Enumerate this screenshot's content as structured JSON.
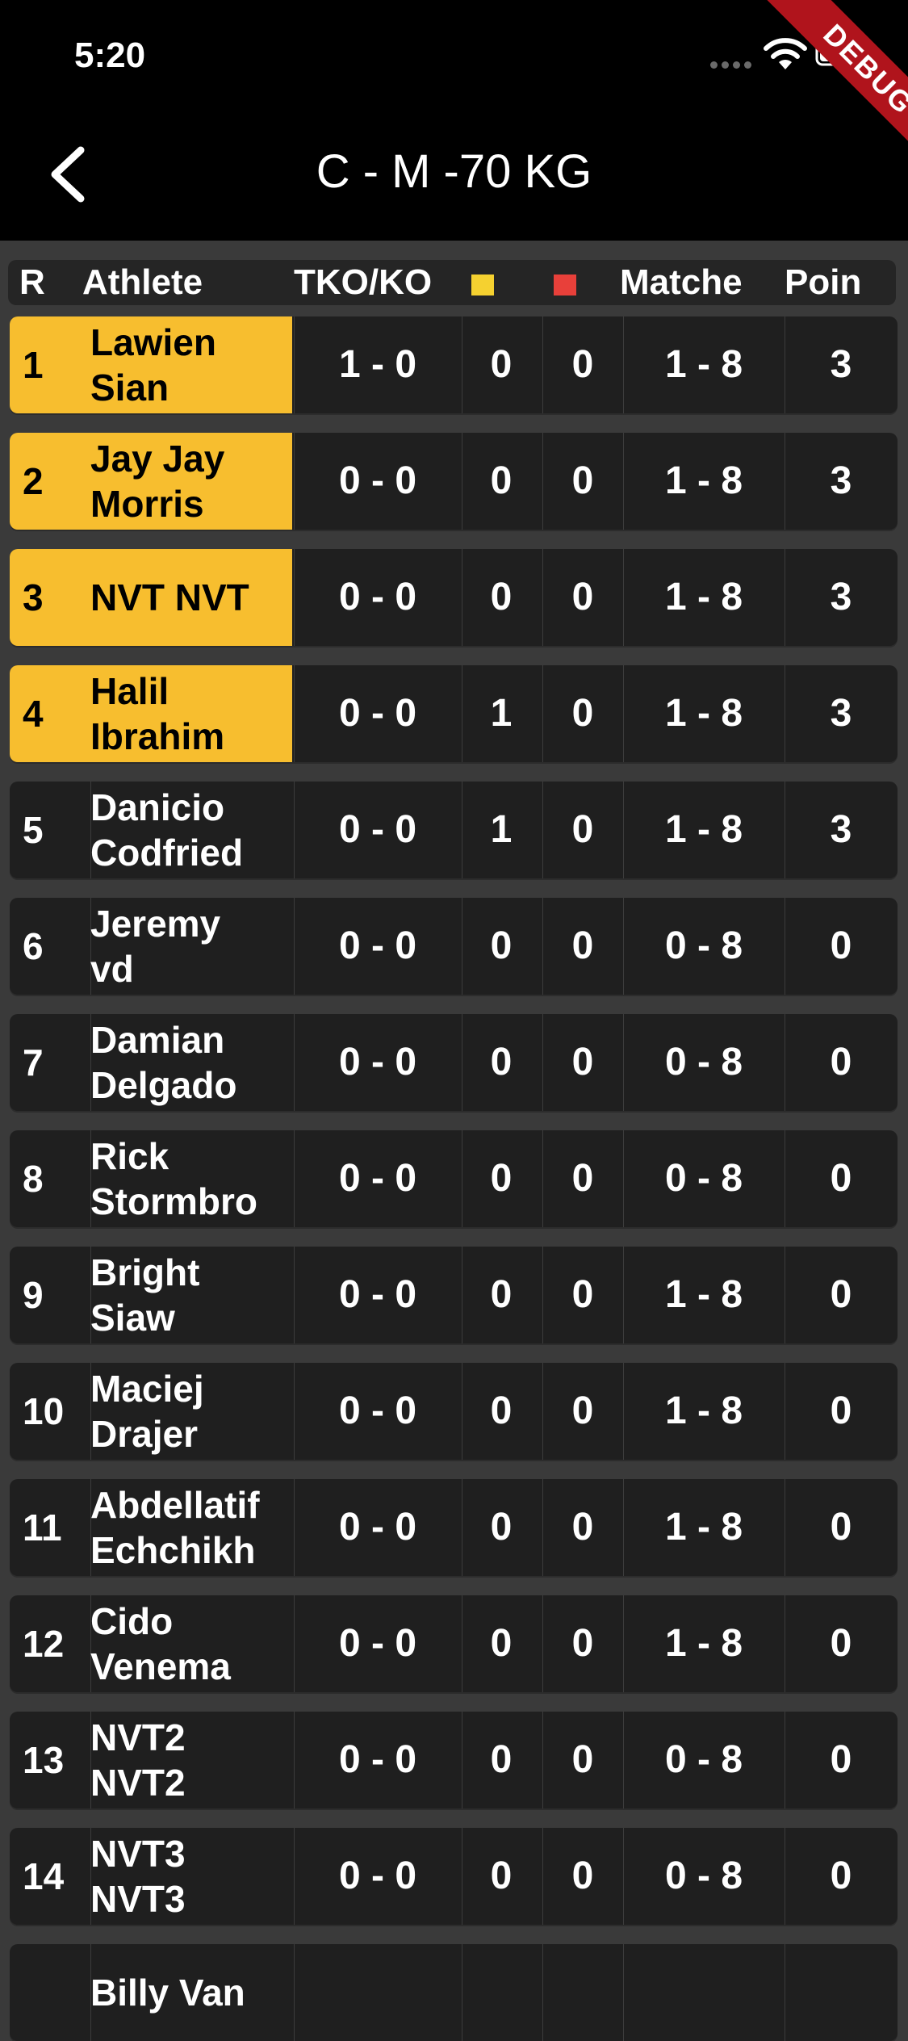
{
  "status_bar": {
    "time": "5:20",
    "debug_label": "DEBUG"
  },
  "nav": {
    "title": "C - M -70 KG",
    "back_icon": "chevron-left-icon"
  },
  "table": {
    "headers": {
      "rank": "R",
      "athlete": "Athlete",
      "tko": "TKO/KO",
      "yellow_card_icon": "yellow-card-icon",
      "red_card_icon": "red-card-icon",
      "matches": "Matche",
      "points": "Poin"
    },
    "colors": {
      "highlight": "#f7be2f",
      "yellow_card": "#f5d130",
      "red_card": "#e8403a",
      "row_bg": "#1f1f1f",
      "page_bg": "#3a3a3a"
    },
    "rows": [
      {
        "rank": "1",
        "athlete": "Lawien\nSian",
        "tko": "1 - 0",
        "yellow": "0",
        "red": "0",
        "matches": "1 - 8",
        "points": "3",
        "highlight": true
      },
      {
        "rank": "2",
        "athlete": "Jay Jay\nMorris",
        "tko": "0 - 0",
        "yellow": "0",
        "red": "0",
        "matches": "1 - 8",
        "points": "3",
        "highlight": true
      },
      {
        "rank": "3",
        "athlete": "NVT NVT",
        "tko": "0 - 0",
        "yellow": "0",
        "red": "0",
        "matches": "1 - 8",
        "points": "3",
        "highlight": true
      },
      {
        "rank": "4",
        "athlete": "Halil\nIbrahim",
        "tko": "0 - 0",
        "yellow": "1",
        "red": "0",
        "matches": "1 - 8",
        "points": "3",
        "highlight": true
      },
      {
        "rank": "5",
        "athlete": "Danicio\nCodfried",
        "tko": "0 - 0",
        "yellow": "1",
        "red": "0",
        "matches": "1 - 8",
        "points": "3",
        "highlight": false
      },
      {
        "rank": "6",
        "athlete": "Jeremy\nvd",
        "tko": "0 - 0",
        "yellow": "0",
        "red": "0",
        "matches": "0 - 8",
        "points": "0",
        "highlight": false
      },
      {
        "rank": "7",
        "athlete": "Damian\nDelgado",
        "tko": "0 - 0",
        "yellow": "0",
        "red": "0",
        "matches": "0 - 8",
        "points": "0",
        "highlight": false
      },
      {
        "rank": "8",
        "athlete": "Rick\nStormbro",
        "tko": "0 - 0",
        "yellow": "0",
        "red": "0",
        "matches": "0 - 8",
        "points": "0",
        "highlight": false
      },
      {
        "rank": "9",
        "athlete": "Bright\nSiaw",
        "tko": "0 - 0",
        "yellow": "0",
        "red": "0",
        "matches": "1 - 8",
        "points": "0",
        "highlight": false
      },
      {
        "rank": "10",
        "athlete": "Maciej\nDrajer",
        "tko": "0 - 0",
        "yellow": "0",
        "red": "0",
        "matches": "1 - 8",
        "points": "0",
        "highlight": false
      },
      {
        "rank": "11",
        "athlete": "Abdellatif\nEchchikh",
        "tko": "0 - 0",
        "yellow": "0",
        "red": "0",
        "matches": "1 - 8",
        "points": "0",
        "highlight": false
      },
      {
        "rank": "12",
        "athlete": "Cido\nVenema",
        "tko": "0 - 0",
        "yellow": "0",
        "red": "0",
        "matches": "1 - 8",
        "points": "0",
        "highlight": false
      },
      {
        "rank": "13",
        "athlete": "NVT2\nNVT2",
        "tko": "0 - 0",
        "yellow": "0",
        "red": "0",
        "matches": "0 - 8",
        "points": "0",
        "highlight": false
      },
      {
        "rank": "14",
        "athlete": "NVT3\nNVT3",
        "tko": "0 - 0",
        "yellow": "0",
        "red": "0",
        "matches": "0 - 8",
        "points": "0",
        "highlight": false
      },
      {
        "rank": "",
        "athlete": "Billy Van",
        "tko": "",
        "yellow": "",
        "red": "",
        "matches": "",
        "points": "",
        "highlight": false
      }
    ]
  }
}
